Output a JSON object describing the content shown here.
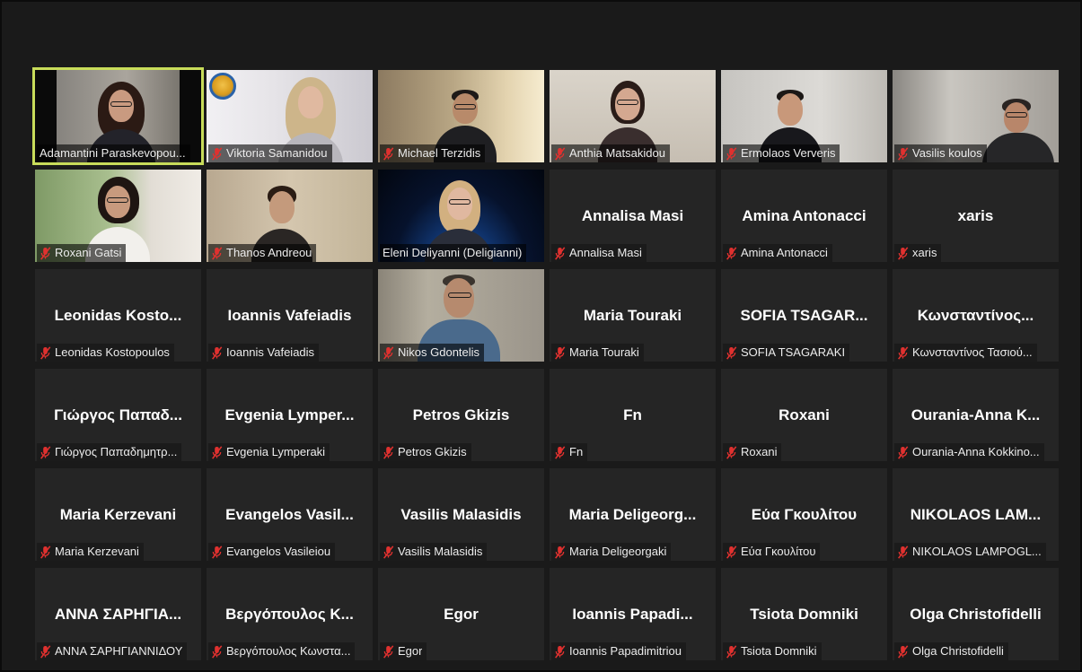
{
  "colors": {
    "window_bg": "#1a1a1a",
    "tile_bg": "#252525",
    "active_speaker_border": "#c8dc5a",
    "muted_icon": "#e0312f",
    "label_text": "#ffffff"
  },
  "icons": {
    "muted": "mic-muted-icon",
    "video_overlay": "organization-logo"
  },
  "participants": [
    {
      "label": "Adamantini Paraskevopou...",
      "video": true,
      "muted": false,
      "active_speaker": true
    },
    {
      "label": "Viktoria Samanidou",
      "video": true,
      "muted": true,
      "video_overlay": "organization-logo"
    },
    {
      "label": "Michael Terzidis",
      "video": true,
      "muted": true
    },
    {
      "label": "Anthia Matsakidou",
      "video": true,
      "muted": true
    },
    {
      "label": "Ermolaos Ververis",
      "video": true,
      "muted": true
    },
    {
      "label": "Vasilis koulos",
      "video": true,
      "muted": true
    },
    {
      "label": "Roxani Gatsi",
      "video": true,
      "muted": true
    },
    {
      "label": "Thanos Andreou",
      "video": true,
      "muted": true
    },
    {
      "label": "Eleni Deliyanni (Deligianni)",
      "video": true,
      "muted": false
    },
    {
      "display_name": "Annalisa Masi",
      "label": "Annalisa Masi",
      "video": false,
      "muted": true
    },
    {
      "display_name": "Amina Antonacci",
      "label": "Amina Antonacci",
      "video": false,
      "muted": true
    },
    {
      "display_name": "xaris",
      "label": "xaris",
      "video": false,
      "muted": true
    },
    {
      "display_name": "Leonidas Kosto...",
      "label": "Leonidas Kostopoulos",
      "video": false,
      "muted": true
    },
    {
      "display_name": "Ioannis Vafeiadis",
      "label": "Ioannis Vafeiadis",
      "video": false,
      "muted": true
    },
    {
      "label": "Nikos Gdontelis",
      "video": true,
      "muted": true
    },
    {
      "display_name": "Maria Touraki",
      "label": "Maria Touraki",
      "video": false,
      "muted": true
    },
    {
      "display_name": "SOFIA TSAGAR...",
      "label": "SOFIA TSAGARAKI",
      "video": false,
      "muted": true
    },
    {
      "display_name": "Κωνσταντίνος...",
      "label": "Κωνσταντίνος Τασιού...",
      "video": false,
      "muted": true
    },
    {
      "display_name": "Γιώργος Παπαδ...",
      "label": "Γιώργος Παπαδημητρ...",
      "video": false,
      "muted": true
    },
    {
      "display_name": "Evgenia Lymper...",
      "label": "Evgenia Lymperaki",
      "video": false,
      "muted": true
    },
    {
      "display_name": "Petros Gkizis",
      "label": "Petros Gkizis",
      "video": false,
      "muted": true
    },
    {
      "display_name": "Fn",
      "label": "Fn",
      "video": false,
      "muted": true
    },
    {
      "display_name": "Roxani",
      "label": "Roxani",
      "video": false,
      "muted": true
    },
    {
      "display_name": "Ourania-Anna K...",
      "label": "Ourania-Anna Kokkino...",
      "video": false,
      "muted": true
    },
    {
      "display_name": "Maria Kerzevani",
      "label": "Maria Kerzevani",
      "video": false,
      "muted": true
    },
    {
      "display_name": "Evangelos Vasil...",
      "label": "Evangelos Vasileiou",
      "video": false,
      "muted": true
    },
    {
      "display_name": "Vasilis Malasidis",
      "label": "Vasilis Malasidis",
      "video": false,
      "muted": true
    },
    {
      "display_name": "Maria Deligeorg...",
      "label": "Maria Deligeorgaki",
      "video": false,
      "muted": true
    },
    {
      "display_name": "Εύα Γκουλίτου",
      "label": "Εύα Γκουλίτου",
      "video": false,
      "muted": true
    },
    {
      "display_name": "NIKOLAOS LAM...",
      "label": "NIKOLAOS LAMPOGL...",
      "video": false,
      "muted": true
    },
    {
      "display_name": "ΑΝΝΑ ΣΑΡΗΓΙΑ...",
      "label": "ΑΝΝΑ ΣΑΡΗΓΙΑΝΝΙΔΟΥ",
      "video": false,
      "muted": true
    },
    {
      "display_name": "Βεργόπουλος Κ...",
      "label": "Βεργόπουλος Κωνστα...",
      "video": false,
      "muted": true
    },
    {
      "display_name": "Egor",
      "label": "Egor",
      "video": false,
      "muted": true
    },
    {
      "display_name": "Ioannis Papadi...",
      "label": "Ioannis Papadimitriou",
      "video": false,
      "muted": true
    },
    {
      "display_name": "Tsiota Domniki",
      "label": "Tsiota Domniki",
      "video": false,
      "muted": true
    },
    {
      "display_name": "Olga Christofidelli",
      "label": "Olga Christofidelli",
      "video": false,
      "muted": true
    }
  ]
}
